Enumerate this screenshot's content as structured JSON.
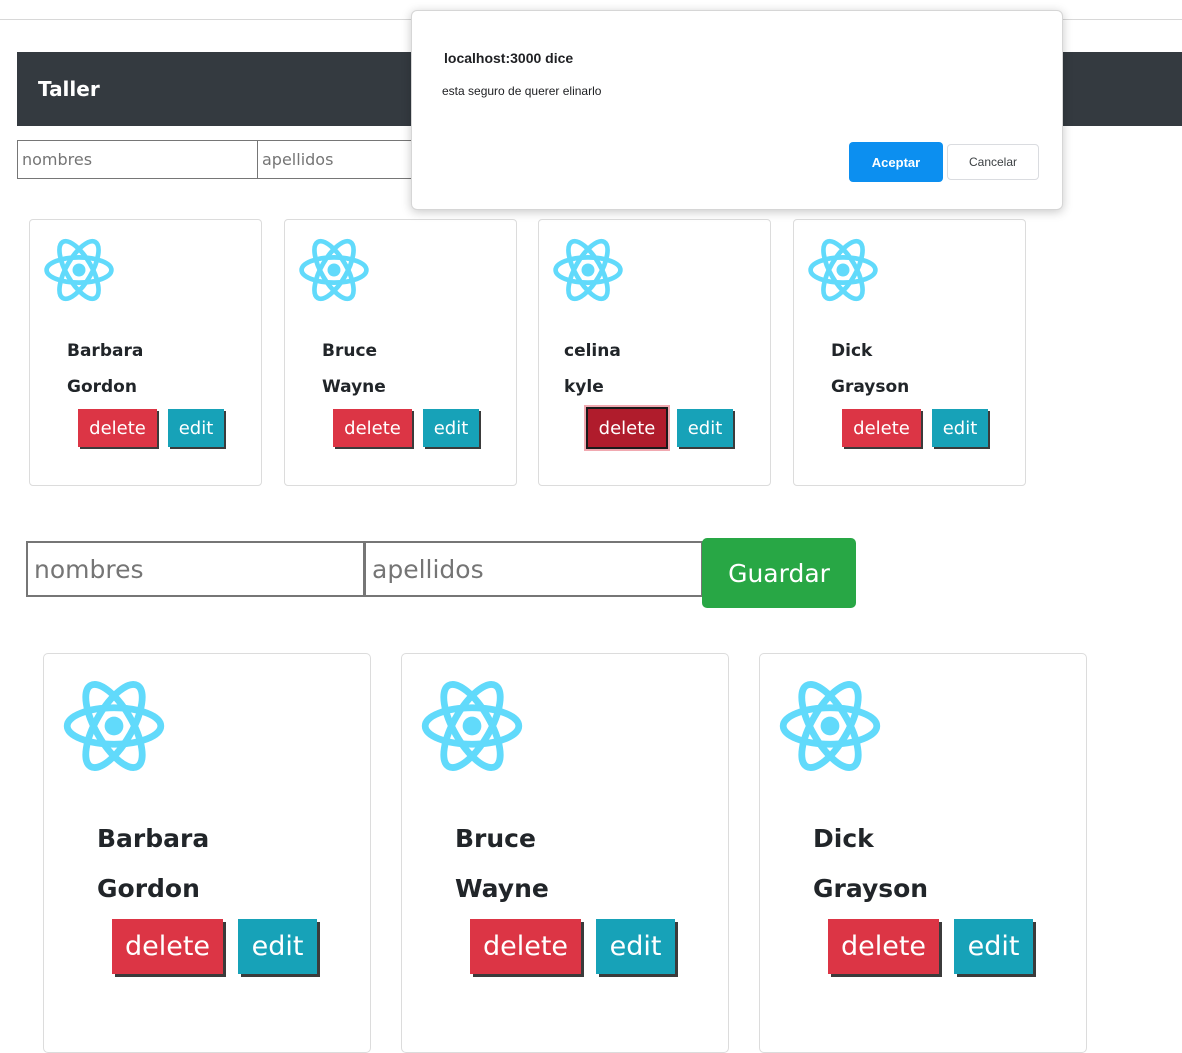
{
  "navbar": {
    "title": "Taller"
  },
  "form_small": {
    "first_placeholder": "nombres",
    "last_placeholder": "apellidos"
  },
  "cards_small": [
    {
      "first": "Barbara",
      "last": "Gordon",
      "delete_label": "delete",
      "edit_label": "edit"
    },
    {
      "first": "Bruce",
      "last": "Wayne",
      "delete_label": "delete",
      "edit_label": "edit"
    },
    {
      "first": "celina",
      "last": "kyle",
      "delete_label": "delete",
      "edit_label": "edit"
    },
    {
      "first": "Dick",
      "last": "Grayson",
      "delete_label": "delete",
      "edit_label": "edit"
    }
  ],
  "form_large": {
    "first_placeholder": "nombres",
    "last_placeholder": "apellidos",
    "save_label": "Guardar"
  },
  "cards_large": [
    {
      "first": "Barbara",
      "last": "Gordon",
      "delete_label": "delete",
      "edit_label": "edit"
    },
    {
      "first": "Bruce",
      "last": "Wayne",
      "delete_label": "delete",
      "edit_label": "edit"
    },
    {
      "first": "Dick",
      "last": "Grayson",
      "delete_label": "delete",
      "edit_label": "edit"
    }
  ],
  "dialog": {
    "title": "localhost:3000 dice",
    "message": "esta seguro de querer elinarlo",
    "ok_label": "Aceptar",
    "cancel_label": "Cancelar"
  },
  "icons": {
    "card_logo": "react-logo-icon"
  },
  "colors": {
    "navbar": "#343a40",
    "delete": "#dc3545",
    "edit": "#17a2b8",
    "save": "#28a745",
    "react_logo": "#61dafb",
    "dialog_ok": "#0c8ff0"
  }
}
